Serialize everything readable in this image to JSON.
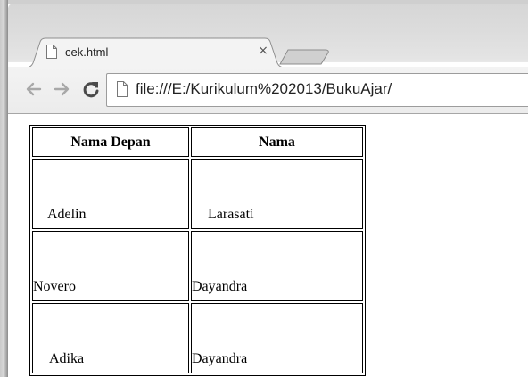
{
  "browser": {
    "tab": {
      "title": "cek.html",
      "close_label": "×"
    },
    "toolbar": {
      "back_icon": "back-arrow-icon",
      "forward_icon": "forward-arrow-icon",
      "reload_icon": "reload-icon",
      "address": "file:///E:/Kurikulum%202013/BukuAjar/"
    }
  },
  "page": {
    "table": {
      "headers": [
        "Nama Depan",
        "Nama"
      ],
      "rows": [
        [
          "Adelin",
          "Larasati"
        ],
        [
          "Novero",
          "Dayandra"
        ],
        [
          "Adika",
          "Dayandra"
        ]
      ]
    }
  }
}
